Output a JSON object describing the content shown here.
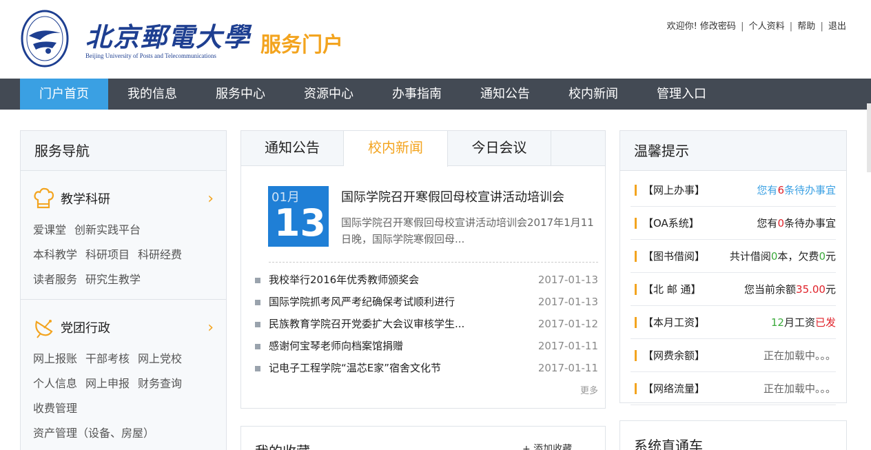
{
  "header": {
    "school_cn": "北京郵電大學",
    "school_en": "Beijing University of Posts and Telecommunications",
    "portal_title": "服务门户",
    "user_links": {
      "welcome": "欢迎你!",
      "change_password": "修改密码",
      "profile": "个人资料",
      "help": "帮助",
      "logout": "退出",
      "sep": "|"
    }
  },
  "nav": [
    "门户首页",
    "我的信息",
    "服务中心",
    "资源中心",
    "办事指南",
    "通知公告",
    "校内新闻",
    "管理入口"
  ],
  "left": {
    "title": "服务导航",
    "groups": [
      {
        "title": "教学科研",
        "chevron": "›",
        "links": [
          [
            "爱课堂",
            "创新实践平台"
          ],
          [
            "本科教学",
            "科研项目",
            "科研经费"
          ],
          [
            "读者服务",
            "研究生教学"
          ]
        ]
      },
      {
        "title": "党团行政",
        "chevron": "›",
        "links": [
          [
            "网上报账",
            "干部考核",
            "网上党校"
          ],
          [
            "个人信息",
            "网上申报",
            "财务查询"
          ],
          [
            "收费管理"
          ],
          [
            "资产管理（设备、房屋）"
          ]
        ]
      }
    ]
  },
  "mid": {
    "tabs": [
      "通知公告",
      "校内新闻",
      "今日会议"
    ],
    "featured": {
      "month": "01月",
      "day": "13",
      "title": "国际学院召开寒假回母校宣讲活动培训会",
      "desc": "国际学院召开寒假回母校宣讲活动培训会2017年1月11日晚，国际学院寒假回母..."
    },
    "news": [
      {
        "title": "我校举行2016年优秀教师颁奖会",
        "date": "2017-01-13"
      },
      {
        "title": "国际学院抓考风严考纪确保考试顺利进行",
        "date": "2017-01-13"
      },
      {
        "title": "民族教育学院召开党委扩大会议审核学生...",
        "date": "2017-01-12"
      },
      {
        "title": "感谢何宝琴老师向档案馆捐赠",
        "date": "2017-01-11"
      },
      {
        "title": "记电子工程学院“温芯E家”宿舍文化节",
        "date": "2017-01-11"
      }
    ],
    "more": "更多"
  },
  "favorites": {
    "title": "我的收藏",
    "add": "+ 添加收藏"
  },
  "right": {
    "title": "温馨提示",
    "tips": [
      {
        "label": "【网上办事】",
        "parts": [
          [
            "您有",
            "blue"
          ],
          [
            "6",
            "red"
          ],
          [
            "条待办事宜",
            "blue"
          ]
        ]
      },
      {
        "label": "【OA系统】",
        "parts": [
          [
            "您有",
            ""
          ],
          [
            "0",
            "red"
          ],
          [
            "条待办事宜",
            ""
          ]
        ]
      },
      {
        "label": "【图书借阅】",
        "parts": [
          [
            "共计借阅",
            ""
          ],
          [
            "0",
            "green"
          ],
          [
            "本，欠费",
            ""
          ],
          [
            "0",
            "green"
          ],
          [
            "元",
            ""
          ]
        ]
      },
      {
        "label": "【北 邮 通】",
        "parts": [
          [
            "您当前余额",
            ""
          ],
          [
            "35.00",
            "red"
          ],
          [
            "元",
            ""
          ]
        ]
      },
      {
        "label": "【本月工资】",
        "parts": [
          [
            "12",
            "green"
          ],
          [
            "月工资",
            ""
          ],
          [
            "已发",
            "red"
          ]
        ]
      },
      {
        "label": "【网费余额】",
        "parts": [
          [
            "正在加载中。。。",
            "grey"
          ]
        ]
      },
      {
        "label": "【网络流量】",
        "parts": [
          [
            "正在加载中。。。",
            "grey"
          ]
        ]
      }
    ]
  },
  "system": {
    "title": "系统直通车"
  },
  "colors": {
    "nav_bg": "#434a54",
    "nav_active": "#3aa0e3",
    "accent": "#f3a41f",
    "date_blue": "#1f7fd6"
  }
}
